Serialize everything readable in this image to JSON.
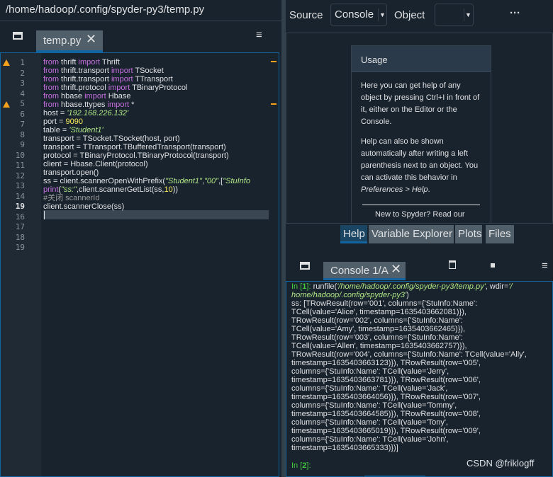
{
  "window": {
    "title": "/home/hadoop/.config/spyder-py3/temp.py"
  },
  "editor": {
    "tab_label": "temp.py",
    "close_glyph": "✕",
    "menu_icon": "≡",
    "line_numbers": [
      "1",
      "2",
      "3",
      "4",
      "5",
      "6",
      "7",
      "8",
      "9",
      "10",
      "11",
      "12",
      "13",
      "14",
      "19",
      "16",
      "17",
      "18",
      "19"
    ],
    "warning_lines": [
      "1",
      "5"
    ],
    "current_line": "19"
  },
  "code": {
    "l1": [
      "from",
      " thrift ",
      "import",
      " Thrift"
    ],
    "l2": [
      "from",
      " thrift.transport ",
      "import",
      " TSocket"
    ],
    "l3": [
      "from",
      " thrift.transport ",
      "import",
      " TTransport"
    ],
    "l4": [
      "from",
      " thrift.protocol ",
      "import",
      " TBinaryProtocol"
    ],
    "l5": [
      "from",
      " hbase ",
      "import",
      " Hbase"
    ],
    "l6": [
      "from",
      " hbase.ttypes ",
      "import",
      " *"
    ],
    "l7": [
      "host = ",
      "'192.168.226.132'"
    ],
    "l8": [
      "port = ",
      "9090"
    ],
    "l9": [
      "table = ",
      "'Student1'"
    ],
    "l10": "transport = TSocket.TSocket(host, port)",
    "l11": "transport = TTransport.TBufferedTransport(transport)",
    "l12": "protocol = TBinaryProtocol.TBinaryProtocol(transport)",
    "l13": "client = Hbase.Client(protocol)",
    "l14": "transport.open()",
    "l15": [
      "ss = client.scannerOpenWithPrefix(",
      "\"Student1\"",
      ",",
      "\"00\"",
      ",[",
      "\"StuInfo"
    ],
    "l16": [
      "print",
      "(",
      "\"ss:\"",
      ",client.scannerGetList(ss,",
      "10",
      "))"
    ],
    "l17": "#关闭 scannerId",
    "l18": "client.scannerClose(ss)"
  },
  "help": {
    "source_label": "Source",
    "source_value": "Console",
    "object_label": "Object",
    "options_glyph": "···",
    "usage_title": "Usage",
    "usage_p1": "Here you can get help of any object by pressing Ctrl+I in front of it, either on the Editor or the Console.",
    "usage_p2a": "Help can also be shown automatically after writing a left parenthesis next to an object. You can activate this behavior in ",
    "usage_p2b": "Preferences > Help",
    "usage_p2c": ".",
    "usage_more": "New to Spyder? Read our",
    "tabs": [
      "Help",
      "Variable Explorer",
      "Plots",
      "Files"
    ]
  },
  "console": {
    "tab_label": "Console 1/A",
    "close_glyph": "✕",
    "menu_icon": "≡",
    "in1_prefix": "In [",
    "in1_num": "1",
    "in1_suffix": "]: ",
    "run_call": "runfile(",
    "run_arg1": "'/home/hadoop/.config/spyder-py3/temp.py'",
    "run_mid": ", wdir=",
    "run_arg2a": "'/",
    "run_arg2b": "home/hadoop/.config/spyder-py3'",
    "run_end": ")",
    "output": [
      "ss: [TRowResult(row='001', columns={'StuInfo:Name':",
      "TCell(value='Alice', timestamp=1635403662081)}),",
      "TRowResult(row='002', columns={'StuInfo:Name':",
      "TCell(value='Amy', timestamp=1635403662465)}),",
      "TRowResult(row='003', columns={'StuInfo:Name':",
      "TCell(value='Allen', timestamp=1635403662757)}),",
      "TRowResult(row='004', columns={'StuInfo:Name': TCell(value='Ally',",
      "timestamp=1635403663123)}), TRowResult(row='005',",
      "columns={'StuInfo:Name': TCell(value='Jerry',",
      "timestamp=1635403663781)}), TRowResult(row='006',",
      "columns={'StuInfo:Name': TCell(value='Jack',",
      "timestamp=1635403664056)}), TRowResult(row='007',",
      "columns={'StuInfo:Name': TCell(value='Tommy',",
      "timestamp=1635403664585)}), TRowResult(row='008',",
      "columns={'StuInfo:Name': TCell(value='Tony',",
      "timestamp=1635403665019)}), TRowResult(row='009',",
      "columns={'StuInfo:Name': TCell(value='John',",
      "timestamp=1635403665333)})]"
    ],
    "in2_prefix": "In [",
    "in2_num": "2",
    "in2_suffix": "]:",
    "watermark": "CSDN @friklogff"
  },
  "colors": {
    "accent": "#1464a0",
    "background": "#19232d",
    "warning": "#f5a21a"
  }
}
